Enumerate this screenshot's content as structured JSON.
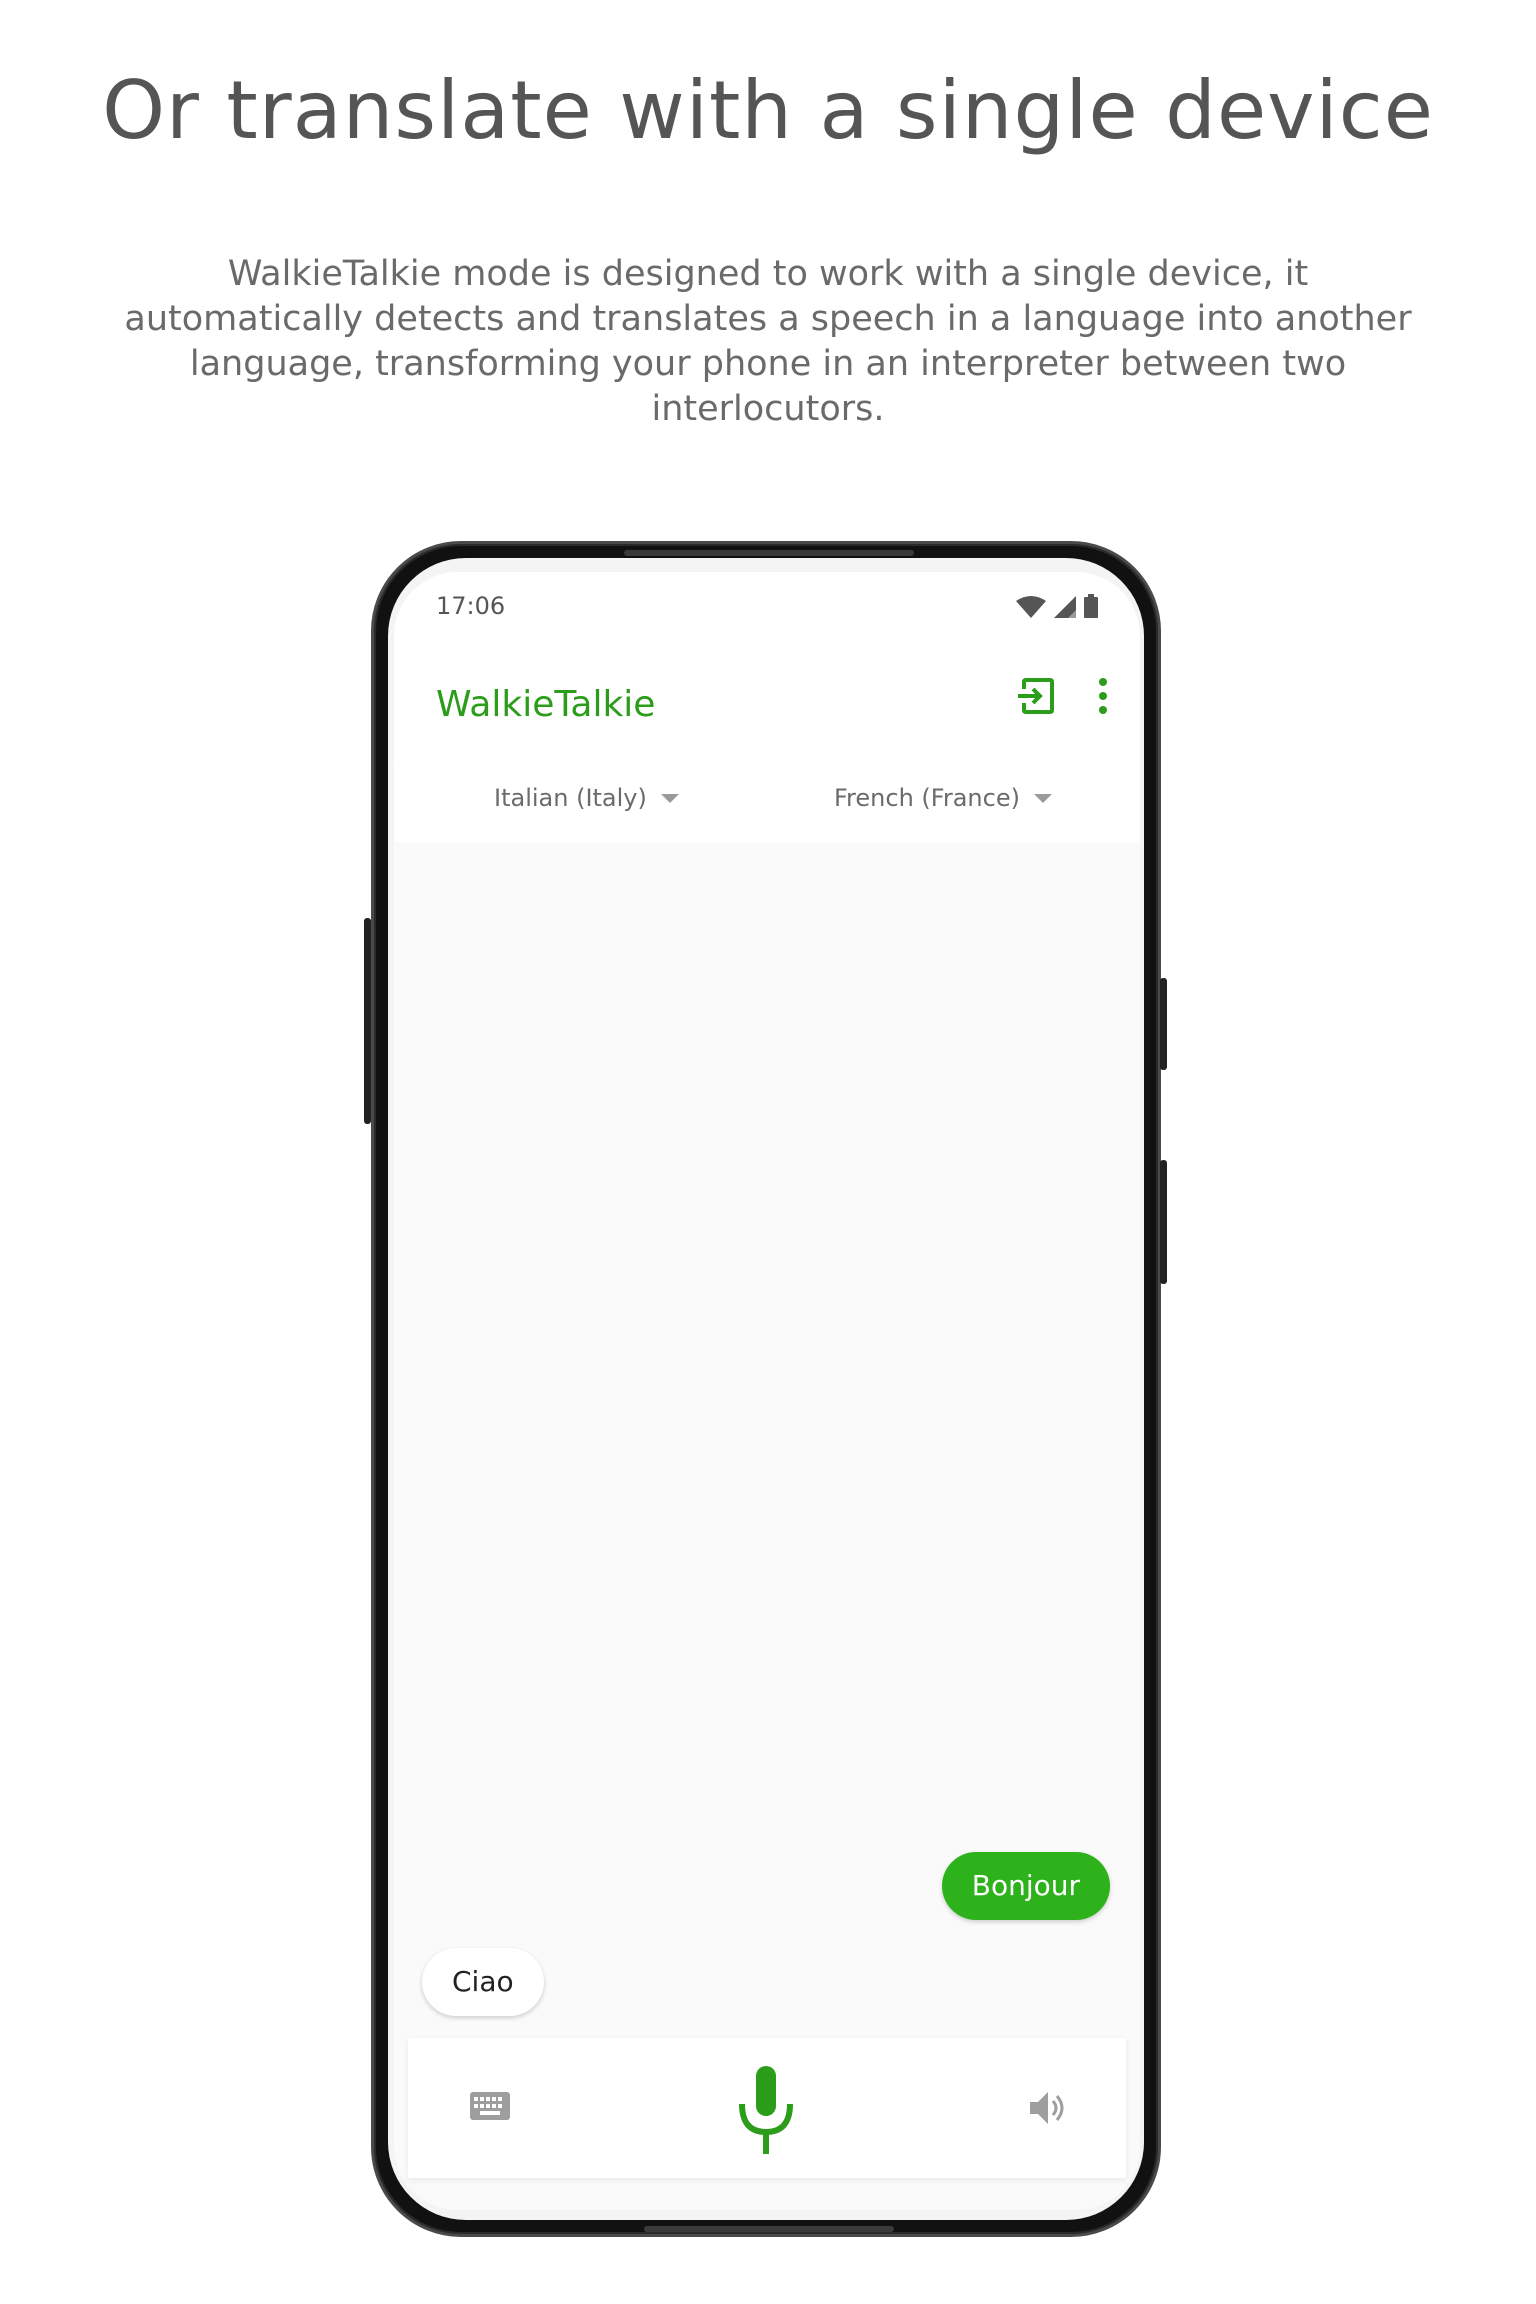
{
  "hero": {
    "title": "Or translate with a single device",
    "description": "WalkieTalkie mode is designed to work with a single device, it automatically detects and translates a speech in a language into another language, transforming your phone in an interpreter between two interlocutors."
  },
  "status_bar": {
    "time": "17:06",
    "icons": [
      "wifi-icon",
      "signal-icon",
      "battery-icon"
    ]
  },
  "app_bar": {
    "title": "WalkieTalkie",
    "actions": [
      "exit-icon",
      "more-vert-icon"
    ]
  },
  "languages": {
    "left": "Italian (Italy)",
    "right": "French (France)"
  },
  "messages": [
    {
      "side": "right",
      "text": "Bonjour"
    },
    {
      "side": "left",
      "text": "Ciao"
    }
  ],
  "bottom_bar": {
    "icons": [
      "keyboard-icon",
      "microphone-icon",
      "speaker-icon"
    ]
  },
  "colors": {
    "accent": "#2c9c1b",
    "bubble_green": "#2db21c",
    "heading_gray": "#555555"
  }
}
